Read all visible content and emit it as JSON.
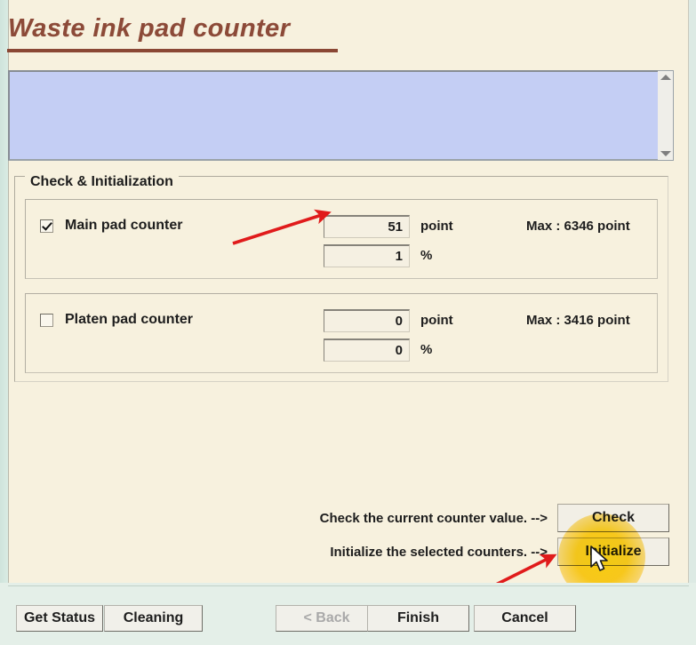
{
  "window": {
    "title": "Waste ink pad counter"
  },
  "log_area": {
    "value": "",
    "placeholder": "",
    "scrollbar": {
      "up_icon": "scroll-up-arrow-icon",
      "down_icon": "scroll-down-arrow-icon"
    }
  },
  "group": {
    "title": "Check & Initialization",
    "counters": [
      {
        "id": "main",
        "label": "Main pad counter",
        "checked": true,
        "point_value": "51",
        "point_unit": "point",
        "percent_value": "1",
        "percent_unit": "%",
        "max_label": "Max : 6346 point"
      },
      {
        "id": "platen",
        "label": "Platen pad counter",
        "checked": false,
        "point_value": "0",
        "point_unit": "point",
        "percent_value": "0",
        "percent_unit": "%",
        "max_label": "Max : 3416 point"
      }
    ]
  },
  "actions": {
    "check_prompt": "Check the current counter value. -->",
    "check_button": "Check",
    "initialize_prompt": "Initialize the selected counters. -->",
    "initialize_button": "Initialize"
  },
  "bottom_bar": {
    "get_status": "Get Status",
    "cleaning": "Cleaning",
    "back": "< Back",
    "finish": "Finish",
    "cancel": "Cancel"
  },
  "colors": {
    "window_background": "#e3efe7",
    "panel_background": "#f7f1de",
    "title_text": "#8c4a38",
    "log_background": "#c4cef4",
    "button_face": "#f2efe6",
    "annotation_arrow": "#e01b1b",
    "click_highlight": "#ffd600",
    "disabled_text": "#a9a9a9"
  },
  "annotations": {
    "arrow_to_main_counter_field": "red-arrow-icon",
    "arrow_to_initialize_button": "red-arrow-icon",
    "click_highlight_on_initialize": "click-highlight-marker",
    "cursor": "mouse-pointer-icon"
  }
}
